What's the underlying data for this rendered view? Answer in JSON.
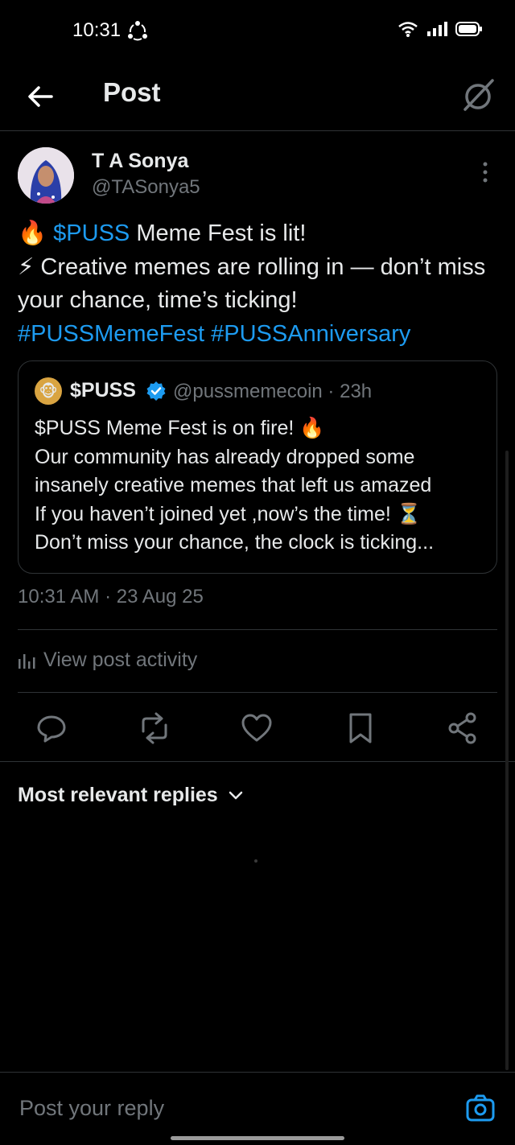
{
  "status": {
    "time": "10:31"
  },
  "header": {
    "title": "Post"
  },
  "post": {
    "author_name": "T A Sonya",
    "author_handle": "@TASonya5",
    "line1_emoji": "🔥",
    "line1_cashtag": "$PUSS",
    "line1_rest": " Meme Fest is lit!",
    "line2": "⚡ Creative memes are rolling in — don’t miss your chance, time’s ticking!",
    "hashtag1": "#PUSSMemeFest",
    "hashtag2": "#PUSSAnniversary",
    "timestamp": "10:31 AM · 23 Aug 25",
    "view_activity": "View post activity"
  },
  "quote": {
    "name": "$PUSS",
    "handle_time": "@pussmemecoin · 23h",
    "lines": [
      "$PUSS Meme Fest is on fire! 🔥",
      "Our community has already dropped some",
      "insanely creative memes that left us amazed",
      "If you haven’t joined yet ,now’s the time! ⏳",
      "Don’t miss your chance, the clock is ticking..."
    ]
  },
  "replies": {
    "title": "Most relevant replies"
  },
  "composer": {
    "placeholder": "Post your reply"
  },
  "colors": {
    "accent": "#1d9bf0",
    "muted": "#71767b",
    "text": "#e7e9ea",
    "divider": "#2f3336"
  }
}
